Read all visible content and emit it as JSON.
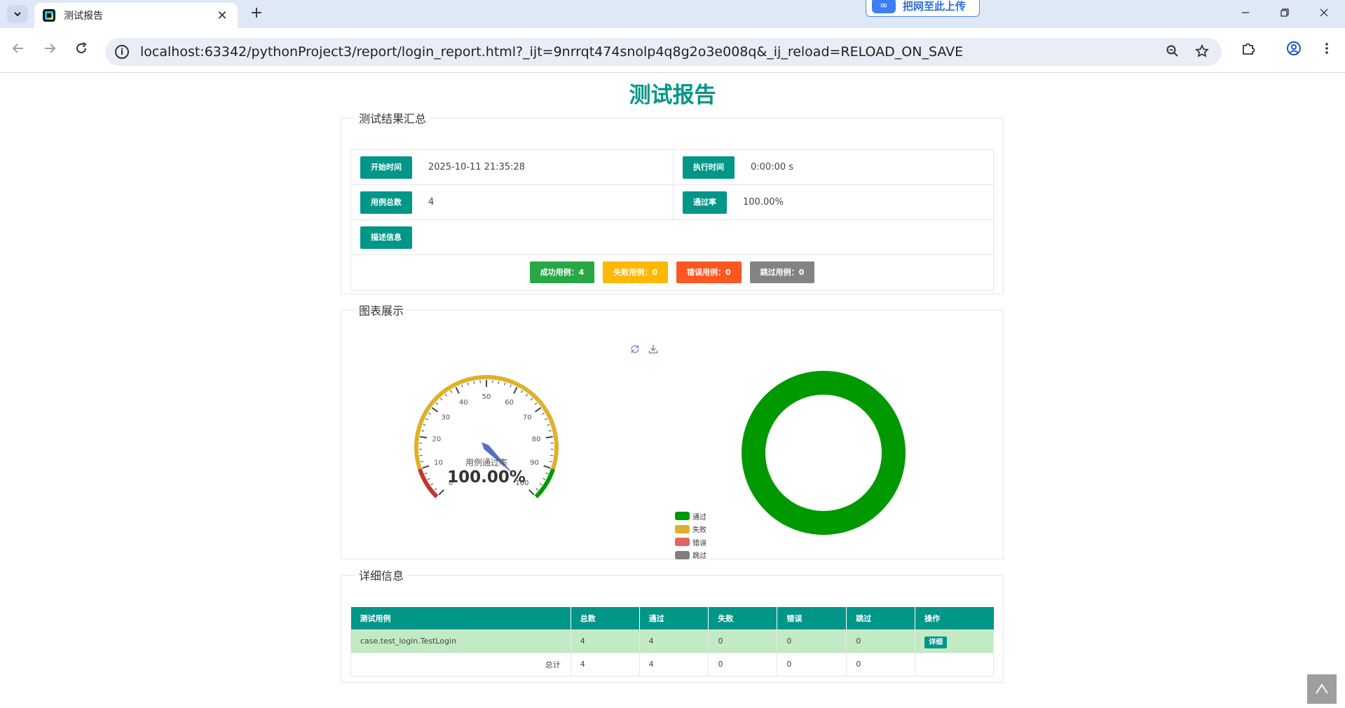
{
  "browser": {
    "tab_title": "测试报告",
    "new_tab_symbol": "+",
    "tab_close_symbol": "✕",
    "extension_badge": "把网至此上传",
    "url": "localhost:63342/pythonProject3/report/login_report.html?_ijt=9nrrqt474snolp4q8g2o3e008q&_ij_reload=RELOAD_ON_SAVE",
    "icons": {
      "tab_search": "chevron-down-icon",
      "back": "arrow-left-icon",
      "forward": "arrow-right-icon",
      "reload": "reload-icon",
      "site_info": "info-icon",
      "zoom": "zoom-icon",
      "bookmark": "star-icon",
      "extensions": "puzzle-icon",
      "profile": "profile-icon",
      "menu": "kebab-menu-icon"
    }
  },
  "report": {
    "title": "测试报告",
    "summary": {
      "legend": "测试结果汇总",
      "start_time_label": "开始时间",
      "start_time": "2025-10-11 21:35:28",
      "run_time_label": "执行时间",
      "run_time": "0:00:00 s",
      "total_label": "用例总数",
      "total": "4",
      "pass_rate_label": "通过率",
      "pass_rate": "100.00%",
      "desc_label": "描述信息",
      "desc": "",
      "status_buttons": [
        {
          "label": "成功用例：4",
          "color": "#28a745"
        },
        {
          "label": "失败用例：0",
          "color": "#ffb800"
        },
        {
          "label": "错误用例：0",
          "color": "#ff5722"
        },
        {
          "label": "跳过用例：0",
          "color": "#838383"
        }
      ]
    },
    "charts": {
      "legend": "图表展示"
    },
    "details": {
      "legend": "详细信息",
      "columns": [
        "测试用例",
        "总数",
        "通过",
        "失败",
        "错误",
        "跳过",
        "操作"
      ],
      "rows": [
        {
          "name": "case.test_login.TestLogin",
          "total": "4",
          "pass": "4",
          "fail": "0",
          "error": "0",
          "skip": "0",
          "action": "详细"
        }
      ],
      "totals": {
        "label": "总计",
        "total": "4",
        "pass": "4",
        "fail": "0",
        "error": "0",
        "skip": "0"
      }
    }
  },
  "chart_data": [
    {
      "type": "gauge",
      "title": "用例通过率",
      "value": 100.0,
      "value_label": "100.00%",
      "min": 0,
      "max": 100,
      "ticks": [
        0,
        10,
        20,
        30,
        40,
        50,
        60,
        70,
        80,
        90,
        100
      ],
      "bands": [
        {
          "to": 0.1,
          "color": "#c23531"
        },
        {
          "to": 0.9,
          "color": "#dfb12a"
        },
        {
          "to": 1.0,
          "color": "#009900"
        }
      ]
    },
    {
      "type": "pie",
      "donut": true,
      "legend_position": "left-bottom",
      "categories": [
        "通过",
        "失败",
        "错误",
        "跳过"
      ],
      "values": [
        4,
        0,
        0,
        0
      ],
      "colors": [
        "#009900",
        "#dfb12a",
        "#e06666",
        "#808080"
      ]
    }
  ]
}
